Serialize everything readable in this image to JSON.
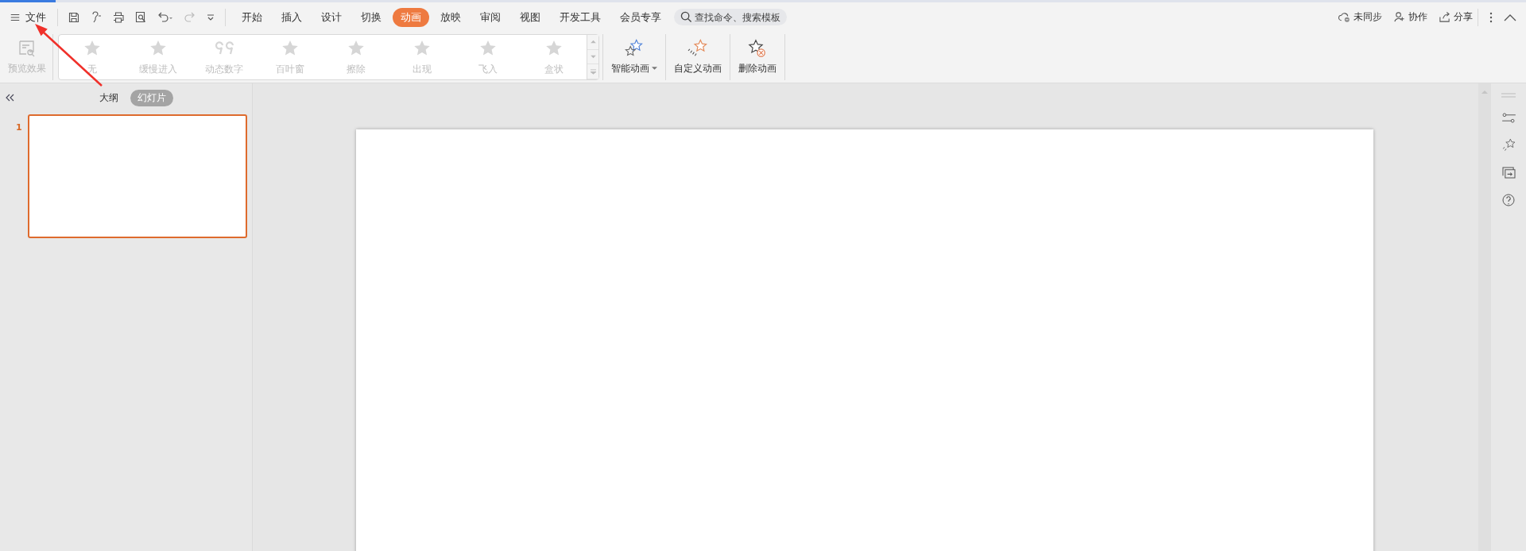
{
  "file_menu": {
    "label": "文件"
  },
  "tabs": [
    {
      "label": "开始",
      "selected": false
    },
    {
      "label": "插入",
      "selected": false
    },
    {
      "label": "设计",
      "selected": false
    },
    {
      "label": "切换",
      "selected": false
    },
    {
      "label": "动画",
      "selected": true
    },
    {
      "label": "放映",
      "selected": false
    },
    {
      "label": "审阅",
      "selected": false
    },
    {
      "label": "视图",
      "selected": false
    },
    {
      "label": "开发工具",
      "selected": false
    },
    {
      "label": "会员专享",
      "selected": false
    }
  ],
  "search": {
    "placeholder": "查找命令、搜索模板"
  },
  "account_actions": [
    {
      "kind": "sync",
      "label": "未同步"
    },
    {
      "kind": "collab",
      "label": "协作"
    },
    {
      "kind": "share",
      "label": "分享"
    }
  ],
  "ribbon": {
    "preview": {
      "label": "预览效果",
      "disabled": true
    },
    "gallery": [
      {
        "kind": "star",
        "label": "无",
        "disabled": true
      },
      {
        "kind": "star",
        "label": "缓慢进入",
        "disabled": true
      },
      {
        "kind": "number",
        "label": "动态数字",
        "disabled": true
      },
      {
        "kind": "star",
        "label": "百叶窗",
        "disabled": true
      },
      {
        "kind": "star",
        "label": "擦除",
        "disabled": true
      },
      {
        "kind": "star",
        "label": "出现",
        "disabled": true
      },
      {
        "kind": "star",
        "label": "飞入",
        "disabled": true
      },
      {
        "kind": "star",
        "label": "盒状",
        "disabled": true
      }
    ],
    "buttons": [
      {
        "kind": "smart",
        "label": "智能动画",
        "dropdown": true
      },
      {
        "kind": "custom",
        "label": "自定义动画",
        "dropdown": false
      },
      {
        "kind": "delete",
        "label": "删除动画",
        "dropdown": false
      }
    ]
  },
  "panel": {
    "views": [
      {
        "label": "大纲",
        "selected": false
      },
      {
        "label": "幻灯片",
        "selected": true
      }
    ],
    "slides": [
      {
        "number": "1",
        "selected": true
      }
    ]
  }
}
